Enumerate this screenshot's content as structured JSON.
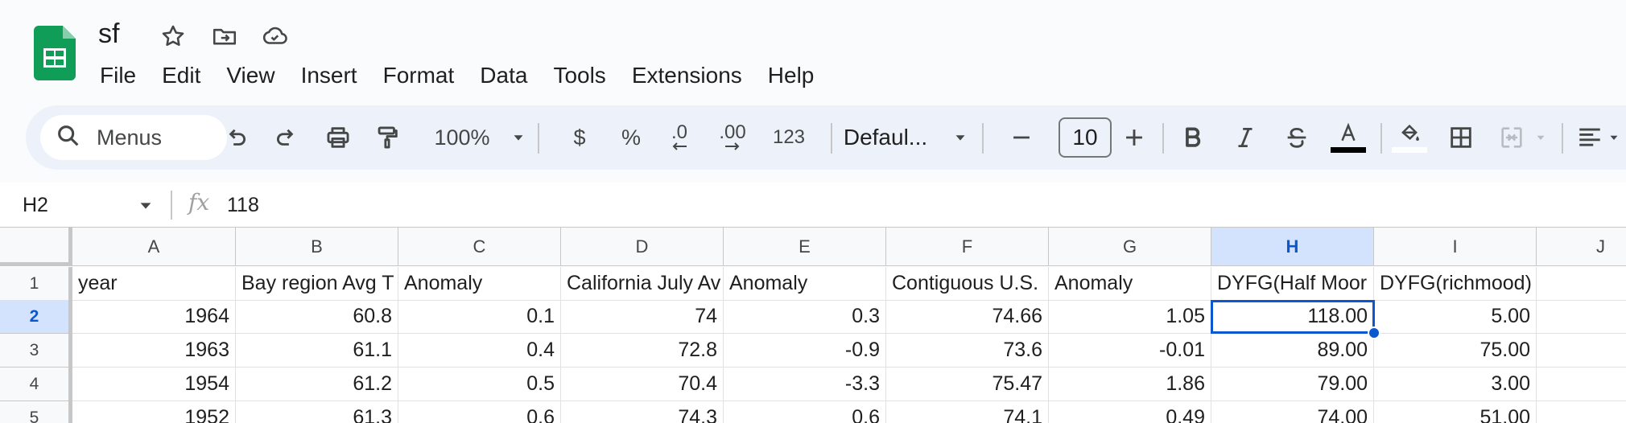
{
  "doc": {
    "title": "sf"
  },
  "menu": [
    "File",
    "Edit",
    "View",
    "Insert",
    "Format",
    "Data",
    "Tools",
    "Extensions",
    "Help"
  ],
  "toolbar": {
    "search_label": "Menus",
    "zoom": "100%",
    "currency": "$",
    "percent": "%",
    "decrease_decimal": ".0",
    "increase_decimal": ".00",
    "more_formats": "123",
    "font": "Defaul...",
    "font_size": "10",
    "text_color": "#000000",
    "fill_color": "#ffffff",
    "accent_color": "#0b57d0"
  },
  "formula_bar": {
    "cell_ref": "H2",
    "fx": "fx",
    "value": "118"
  },
  "grid": {
    "columns": [
      "A",
      "B",
      "C",
      "D",
      "E",
      "F",
      "G",
      "H",
      "I",
      "J"
    ],
    "selected_column": "H",
    "selected_row": "2",
    "rows": [
      {
        "n": "1",
        "cells": [
          "year",
          "Bay region Avg T",
          "Anomaly",
          "California July Av",
          "Anomaly",
          "Contiguous U.S.",
          "Anomaly",
          "DYFG(Half Moor",
          "DYFG(richmood)",
          ""
        ]
      },
      {
        "n": "2",
        "cells": [
          "1964",
          "60.8",
          "0.1",
          "74",
          "0.3",
          "74.66",
          "1.05",
          "118.00",
          "5.00",
          ""
        ]
      },
      {
        "n": "3",
        "cells": [
          "1963",
          "61.1",
          "0.4",
          "72.8",
          "-0.9",
          "73.6",
          "-0.01",
          "89.00",
          "75.00",
          ""
        ]
      },
      {
        "n": "4",
        "cells": [
          "1954",
          "61.2",
          "0.5",
          "70.4",
          "-3.3",
          "75.47",
          "1.86",
          "79.00",
          "3.00",
          ""
        ]
      },
      {
        "n": "5",
        "cells": [
          "1952",
          "61.3",
          "0.6",
          "74.3",
          "0.6",
          "74.1",
          "0.49",
          "74.00",
          "51.00",
          ""
        ]
      }
    ]
  }
}
